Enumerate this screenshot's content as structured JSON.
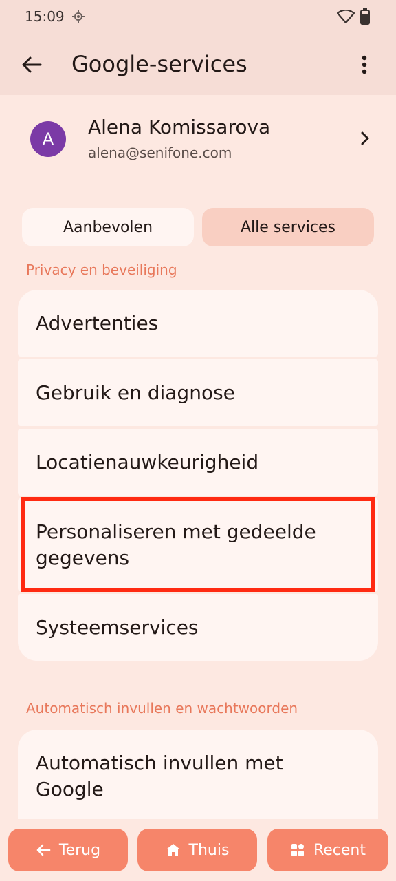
{
  "status_bar": {
    "time": "15:09"
  },
  "app_bar": {
    "title": "Google-services"
  },
  "account": {
    "initial": "A",
    "name": "Alena Komissarova",
    "email": "alena@senifone.com"
  },
  "tabs": [
    {
      "label": "Aanbevolen",
      "selected": false
    },
    {
      "label": "Alle services",
      "selected": true
    }
  ],
  "sections": [
    {
      "label": "Privacy en beveiliging",
      "items": [
        {
          "label": "Advertenties"
        },
        {
          "label": "Gebruik en diagnose"
        },
        {
          "label": "Locatienauwkeurigheid"
        },
        {
          "label": "Personaliseren met gedeelde gegevens"
        },
        {
          "label": "Systeemservices"
        }
      ]
    },
    {
      "label": "Automatisch invullen en wachtwoorden",
      "items": [
        {
          "label": "Automatisch invullen met Google"
        }
      ]
    }
  ],
  "bottom_nav": {
    "back": "Terug",
    "home": "Thuis",
    "recent": "Recent"
  },
  "colors": {
    "highlight": "#ff2a12",
    "accent": "#f6856a",
    "section_label": "#e8785b"
  }
}
